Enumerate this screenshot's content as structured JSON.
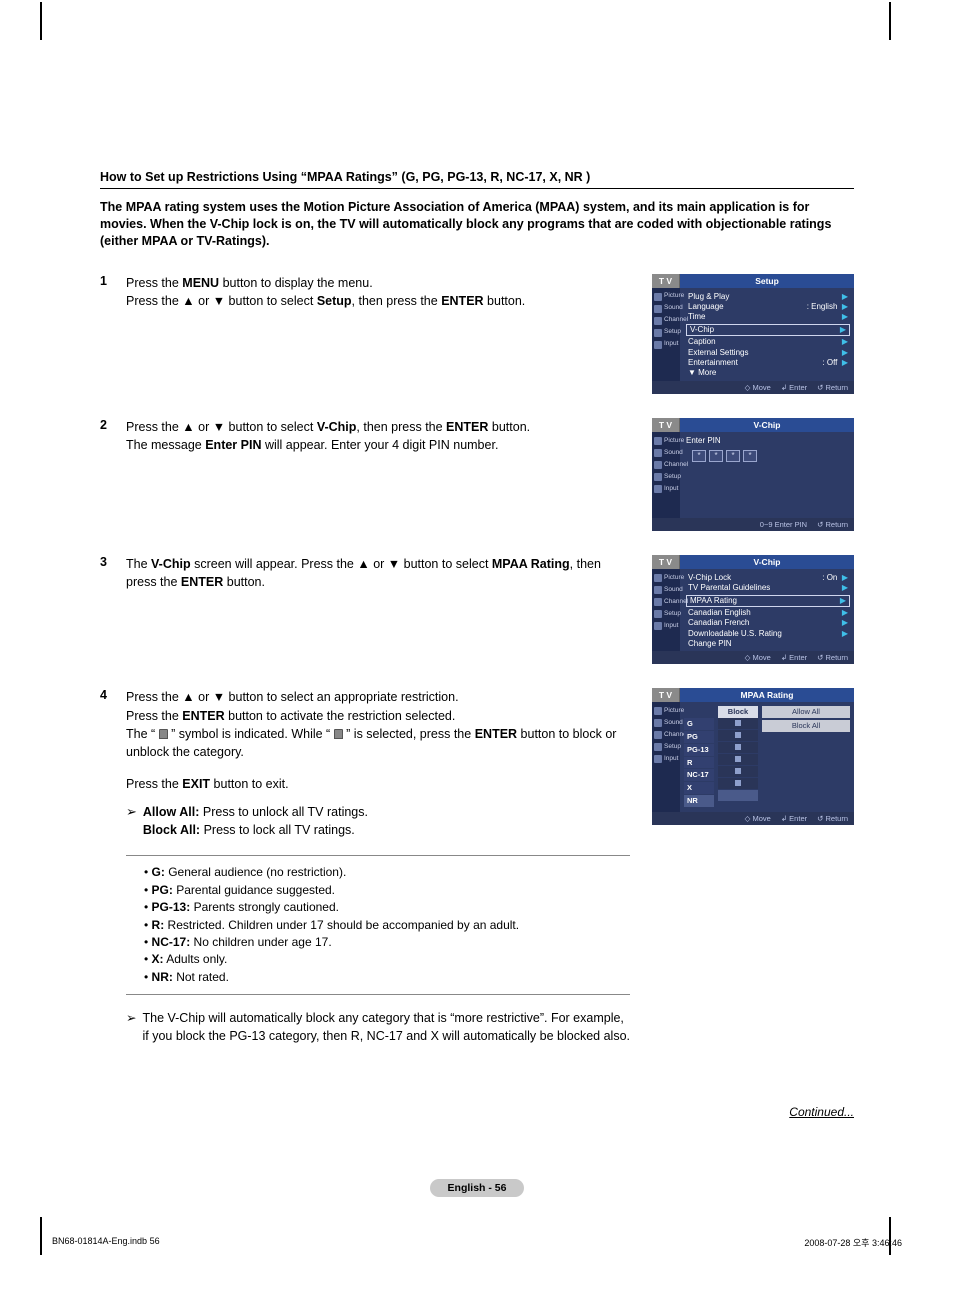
{
  "section_title": "How to Set up Restrictions Using “MPAA Ratings” (G, PG, PG-13, R, NC-17, X, NR )",
  "intro": "The MPAA rating system uses the Motion Picture Association of America (MPAA) system, and its main application is for movies. When the V-Chip lock is on, the TV will automatically block any programs that are coded with objectionable ratings (either MPAA or TV-Ratings).",
  "steps": {
    "1": {
      "num": "1",
      "line1a": "Press the ",
      "menu": "MENU",
      "line1b": " button to display the menu.",
      "line2a": "Press the ▲ or ▼ button to select ",
      "setup": "Setup",
      "line2b": ", then press the ",
      "enter": "ENTER",
      "line2c": " button."
    },
    "2": {
      "num": "2",
      "line1a": "Press the ▲ or ▼ button to select ",
      "vchip": "V-Chip",
      "line1b": ", then press the ",
      "enter": "ENTER",
      "line1c": " button.",
      "line2a": "The message ",
      "enter_pin": "Enter PIN",
      "line2b": " will appear. Enter your 4 digit PIN number."
    },
    "3": {
      "num": "3",
      "line1a": "The ",
      "vchip": "V-Chip",
      "line1b": " screen will appear. Press the ▲ or ▼ button to select ",
      "mpaa": "MPAA Rating",
      "line1c": ", then press the ",
      "enter": "ENTER",
      "line1d": " button."
    },
    "4": {
      "num": "4",
      "line1": "Press the ▲ or ▼ button to select an appropriate restriction.",
      "line2a": "Press the ",
      "enter": "ENTER",
      "line2b": " button to activate the restriction selected.",
      "line3a": "The “ ",
      "line3b": " ” symbol is indicated. While “ ",
      "line3c": " ” is selected, press the ",
      "line3d": " button to block or unblock the category.",
      "exit_a": "Press the ",
      "exit_b": "EXIT",
      "exit_c": " button to exit.",
      "allow_label": "Allow All:",
      "allow_text": " Press to unlock all TV ratings.",
      "block_label": "Block All:",
      "block_text": " Press to lock all TV ratings."
    }
  },
  "definitions": [
    {
      "code": "G:",
      "text": " General audience (no restriction)."
    },
    {
      "code": "PG:",
      "text": " Parental guidance suggested."
    },
    {
      "code": "PG-13:",
      "text": " Parents strongly cautioned."
    },
    {
      "code": "R:",
      "text": " Restricted. Children under 17 should be accompanied by an adult."
    },
    {
      "code": "NC-17:",
      "text": " No children under age 17."
    },
    {
      "code": "X:",
      "text": " Adults only."
    },
    {
      "code": "NR:",
      "text": " Not rated."
    }
  ],
  "auto_note": "The V-Chip will automatically block any category that is “more restrictive”. For example, if you block the PG-13 category, then R, NC-17 and X will automatically be blocked also.",
  "continued": "Continued...",
  "page_pill": "English - 56",
  "footer_left": "BN68-01814A-Eng.indb   56",
  "footer_right": "2008-07-28   오후 3:46:46",
  "osd": {
    "tv": "T V",
    "side": [
      "Picture",
      "Sound",
      "Channel",
      "Setup",
      "Input"
    ],
    "foot": {
      "move": "◇ Move",
      "enter": "↲ Enter",
      "ret": "↺ Return"
    },
    "setup": {
      "title": "Setup",
      "items": [
        {
          "label": "Plug & Play",
          "val": ""
        },
        {
          "label": "Language",
          "val": ": English"
        },
        {
          "label": "Time",
          "val": ""
        },
        {
          "label": "V-Chip",
          "val": "",
          "boxed": true
        },
        {
          "label": "Caption",
          "val": ""
        },
        {
          "label": "External Settings",
          "val": ""
        },
        {
          "label": "Entertainment",
          "val": ": Off"
        }
      ],
      "more": "▼ More"
    },
    "pin": {
      "title": "V-Chip",
      "label": "Enter PIN",
      "mask": "*",
      "foot_enter": "0~9 Enter PIN",
      "foot_ret": "↺ Return"
    },
    "vchip_menu": {
      "title": "V-Chip",
      "items": [
        {
          "label": "V-Chip Lock",
          "val": ": On"
        },
        {
          "label": "TV Parental Guidelines",
          "val": ""
        },
        {
          "label": "MPAA Rating",
          "val": "",
          "boxed": true
        },
        {
          "label": "Canadian English",
          "val": ""
        },
        {
          "label": "Canadian French",
          "val": ""
        },
        {
          "label": "Downloadable U.S. Rating",
          "val": ""
        },
        {
          "label": "Change PIN",
          "val": ""
        }
      ]
    },
    "mpaa": {
      "title": "MPAA Rating",
      "block_hdr": "Block",
      "allow_all": "Allow All",
      "block_all": "Block All",
      "rows": [
        "G",
        "PG",
        "PG-13",
        "R",
        "NC-17",
        "X",
        "NR"
      ],
      "foot_move": "◇ Move"
    }
  }
}
